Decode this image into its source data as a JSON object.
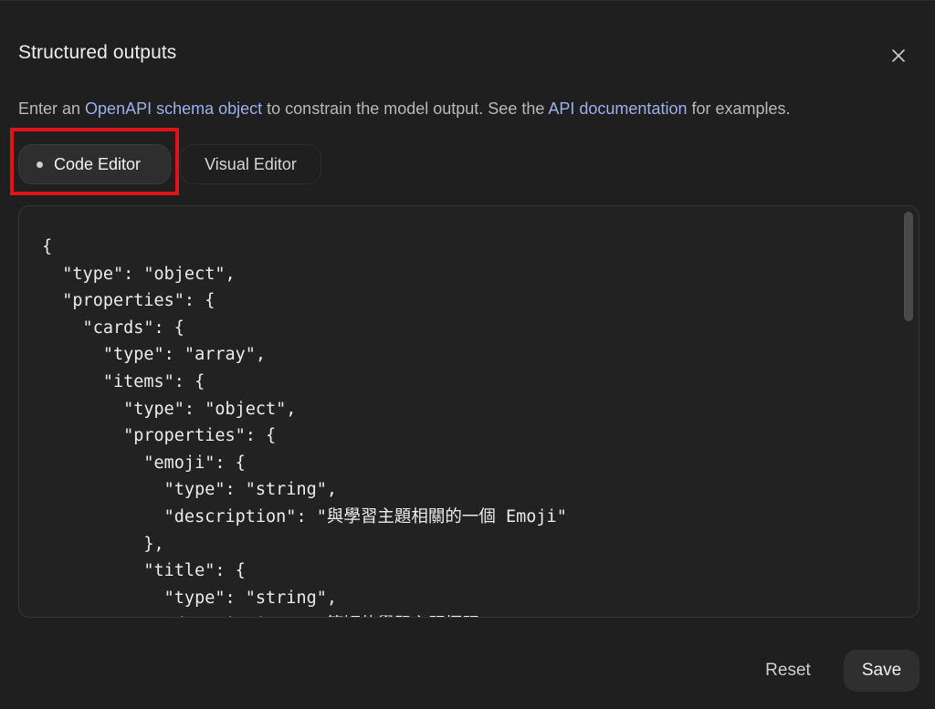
{
  "dialog": {
    "title": "Structured outputs",
    "description": {
      "prefix": "Enter an ",
      "link1": "OpenAPI schema object",
      "middle": " to constrain the model output. See the ",
      "link2": "API documentation",
      "suffix": " for examples."
    }
  },
  "tabs": [
    {
      "label": "Code Editor",
      "active": true
    },
    {
      "label": "Visual Editor",
      "active": false
    }
  ],
  "editor": {
    "lines": [
      "{",
      "  \"type\": \"object\",",
      "  \"properties\": {",
      "    \"cards\": {",
      "      \"type\": \"array\",",
      "      \"items\": {",
      "        \"type\": \"object\",",
      "        \"properties\": {",
      "          \"emoji\": {",
      "            \"type\": \"string\",",
      "            \"description\": \"與學習主題相關的一個 Emoji\"",
      "          },",
      "          \"title\": {",
      "            \"type\": \"string\",",
      "            \"description\": \"簡短的學習主題標題\""
    ]
  },
  "footer": {
    "reset_label": "Reset",
    "save_label": "Save"
  },
  "icons": {
    "close": "close-icon"
  },
  "colors": {
    "background": "#1f1f1f",
    "link": "#9cb0ee",
    "highlight": "#e0131b"
  }
}
